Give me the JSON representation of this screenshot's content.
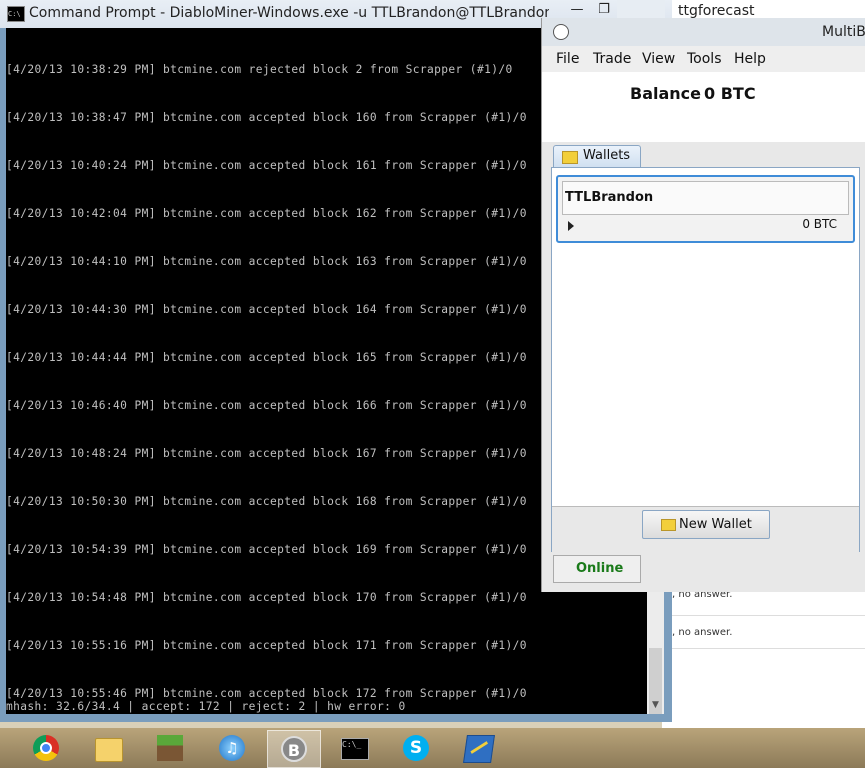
{
  "background_window": {
    "title": "ttgforecast",
    "rows": [
      ", no answer.",
      ", no answer."
    ]
  },
  "cmd": {
    "title": "Command Prompt - DiabloMiner-Windows.exe  -u TTLBrandon@TTLBrandon -p",
    "window_buttons": {
      "minimize": "—",
      "maximize": "❐",
      "close": "✕"
    },
    "lines": [
      "[4/20/13 10:38:29 PM] btcmine.com rejected block 2 from Scrapper (#1)/0",
      "[4/20/13 10:38:47 PM] btcmine.com accepted block 160 from Scrapper (#1)/0",
      "[4/20/13 10:40:24 PM] btcmine.com accepted block 161 from Scrapper (#1)/0",
      "[4/20/13 10:42:04 PM] btcmine.com accepted block 162 from Scrapper (#1)/0",
      "[4/20/13 10:44:10 PM] btcmine.com accepted block 163 from Scrapper (#1)/0",
      "[4/20/13 10:44:30 PM] btcmine.com accepted block 164 from Scrapper (#1)/0",
      "[4/20/13 10:44:44 PM] btcmine.com accepted block 165 from Scrapper (#1)/0",
      "[4/20/13 10:46:40 PM] btcmine.com accepted block 166 from Scrapper (#1)/0",
      "[4/20/13 10:48:24 PM] btcmine.com accepted block 167 from Scrapper (#1)/0",
      "[4/20/13 10:50:30 PM] btcmine.com accepted block 168 from Scrapper (#1)/0",
      "[4/20/13 10:54:39 PM] btcmine.com accepted block 169 from Scrapper (#1)/0",
      "[4/20/13 10:54:48 PM] btcmine.com accepted block 170 from Scrapper (#1)/0",
      "[4/20/13 10:55:16 PM] btcmine.com accepted block 171 from Scrapper (#1)/0",
      "[4/20/13 10:55:46 PM] btcmine.com accepted block 172 from Scrapper (#1)/0"
    ],
    "status_line": "mhash: 32.6/34.4 | accept: 172 | reject: 2 | hw error: 0"
  },
  "multibit": {
    "title": "MultiB",
    "menu": {
      "file": "File",
      "trade": "Trade",
      "view": "View",
      "tools": "Tools",
      "help": "Help"
    },
    "balance_label": "Balance",
    "balance_value": "0 BTC",
    "tab_label": "Wallets",
    "wallet": {
      "name": "TTLBrandon",
      "balance": "0 BTC"
    },
    "new_wallet_label": "New Wallet",
    "status": "Online"
  },
  "taskbar": {
    "items": [
      "chrome-icon",
      "file-explorer-icon",
      "minecraft-icon",
      "itunes-icon",
      "multibit-icon",
      "command-prompt-icon",
      "skype-icon",
      "notepad-icon"
    ],
    "active": "multibit-icon"
  },
  "colors": {
    "console_bg": "#000000",
    "console_text": "#c0c0c0",
    "online": "#1a7a1a",
    "accent": "#3f8cd8"
  }
}
